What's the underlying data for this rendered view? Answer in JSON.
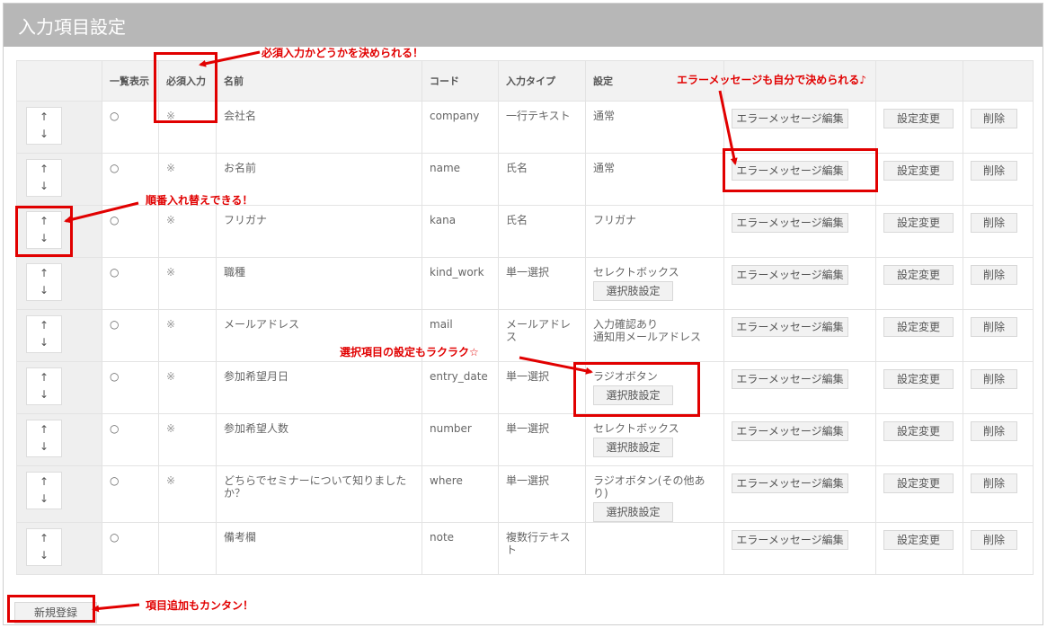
{
  "header": {
    "title": "入力項目設定"
  },
  "columns": {
    "list": "一覧表示",
    "required": "必須入力",
    "name": "名前",
    "code": "コード",
    "type": "入力タイプ",
    "setting": "設定"
  },
  "buttons": {
    "error": "エラーメッセージ編集",
    "change": "設定変更",
    "delete": "削除",
    "options": "選択肢設定",
    "new": "新規登録"
  },
  "arrows": {
    "up": "↑",
    "down": "↓"
  },
  "rows": [
    {
      "list": "○",
      "required": "※",
      "name": "会社名",
      "code": "company",
      "type": "一行テキスト",
      "setting": "通常",
      "setting2": ""
    },
    {
      "list": "○",
      "required": "※",
      "name": "お名前",
      "code": "name",
      "type": "氏名",
      "setting": "通常",
      "setting2": ""
    },
    {
      "list": "○",
      "required": "※",
      "name": "フリガナ",
      "code": "kana",
      "type": "氏名",
      "setting": "フリガナ",
      "setting2": ""
    },
    {
      "list": "○",
      "required": "※",
      "name": "職種",
      "code": "kind_work",
      "type": "単一選択",
      "setting": "セレクトボックス",
      "setting2": ""
    },
    {
      "list": "○",
      "required": "※",
      "name": "メールアドレス",
      "code": "mail",
      "type": "メールアドレス",
      "setting": "入力確認あり",
      "setting2": "通知用メールアドレス"
    },
    {
      "list": "○",
      "required": "※",
      "name": "参加希望月日",
      "code": "entry_date",
      "type": "単一選択",
      "setting": "ラジオボタン",
      "setting2": ""
    },
    {
      "list": "○",
      "required": "※",
      "name": "参加希望人数",
      "code": "number",
      "type": "単一選択",
      "setting": "セレクトボックス",
      "setting2": ""
    },
    {
      "list": "○",
      "required": "※",
      "name": "どちらでセミナーについて知りましたか？",
      "code": "where",
      "type": "単一選択",
      "setting": "ラジオボタン(その他あり)",
      "setting2": ""
    },
    {
      "list": "○",
      "required": "",
      "name": "備考欄",
      "code": "note",
      "type": "複数行テキスト",
      "setting": "",
      "setting2": ""
    }
  ],
  "annotations": {
    "required": "必須入力かどうかを決められる！",
    "error": "エラーメッセージも自分で決められる♪",
    "order": "順番入れ替えできる！",
    "options": "選択項目の設定もラクラク☆",
    "add": "項目追加もカンタン！"
  },
  "accent_color": "#e10000"
}
